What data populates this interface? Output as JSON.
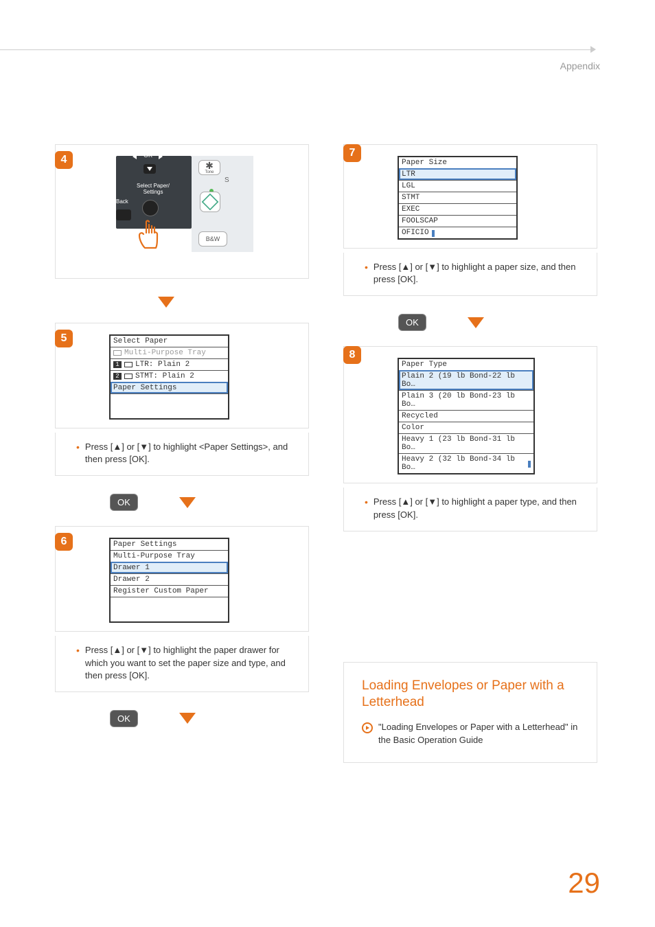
{
  "header": {
    "label": "Appendix"
  },
  "page_number": "29",
  "steps": {
    "s4": {
      "num": "4",
      "panel": {
        "ok": "OK",
        "select": "Select Paper/\nSettings",
        "back": "Back",
        "tone_sym": "✱",
        "tone": "Tone",
        "s": "S",
        "bw": "B&W"
      }
    },
    "s5": {
      "num": "5",
      "lcd": {
        "title": "Select Paper",
        "r1": "Multi-Purpose Tray",
        "r2a": "1",
        "r2b": "LTR: Plain 2",
        "r3a": "2",
        "r3b": "STMT: Plain 2",
        "r4": "Paper Settings"
      },
      "instr": "Press [▲] or [▼] to highlight <Paper Settings>, and then press [OK]."
    },
    "s6": {
      "num": "6",
      "lcd": {
        "title": "Paper Settings",
        "r1": "Multi-Purpose Tray",
        "r2": "Drawer 1",
        "r3": "Drawer 2",
        "r4": "Register Custom Paper"
      },
      "instr": "Press [▲] or [▼] to highlight the paper drawer for which you want to set the paper size and type, and then press [OK]."
    },
    "s7": {
      "num": "7",
      "lcd": {
        "title": "Paper Size",
        "r1": "LTR",
        "r2": "LGL",
        "r3": "STMT",
        "r4": "EXEC",
        "r5": "FOOLSCAP",
        "r6": "OFICIO"
      },
      "instr": "Press [▲] or [▼] to highlight a paper size, and then press [OK]."
    },
    "s8": {
      "num": "8",
      "lcd": {
        "title": "Paper Type",
        "r1": "Plain 2 (19 lb Bond-22 lb Bo…",
        "r2": "Plain 3 (20 lb Bond-23 lb Bo…",
        "r3": "Recycled",
        "r4": "Color",
        "r5": "Heavy 1 (23 lb Bond-31 lb Bo…",
        "r6": "Heavy 2 (32 lb Bond-34 lb Bo…"
      },
      "instr": "Press [▲] or [▼] to highlight a paper type, and then press [OK]."
    }
  },
  "ok_label": "OK",
  "callout": {
    "title": "Loading Envelopes or Paper with a Letterhead",
    "body": "\"Loading Envelopes or Paper with a Letterhead\" in the Basic Operation Guide"
  }
}
